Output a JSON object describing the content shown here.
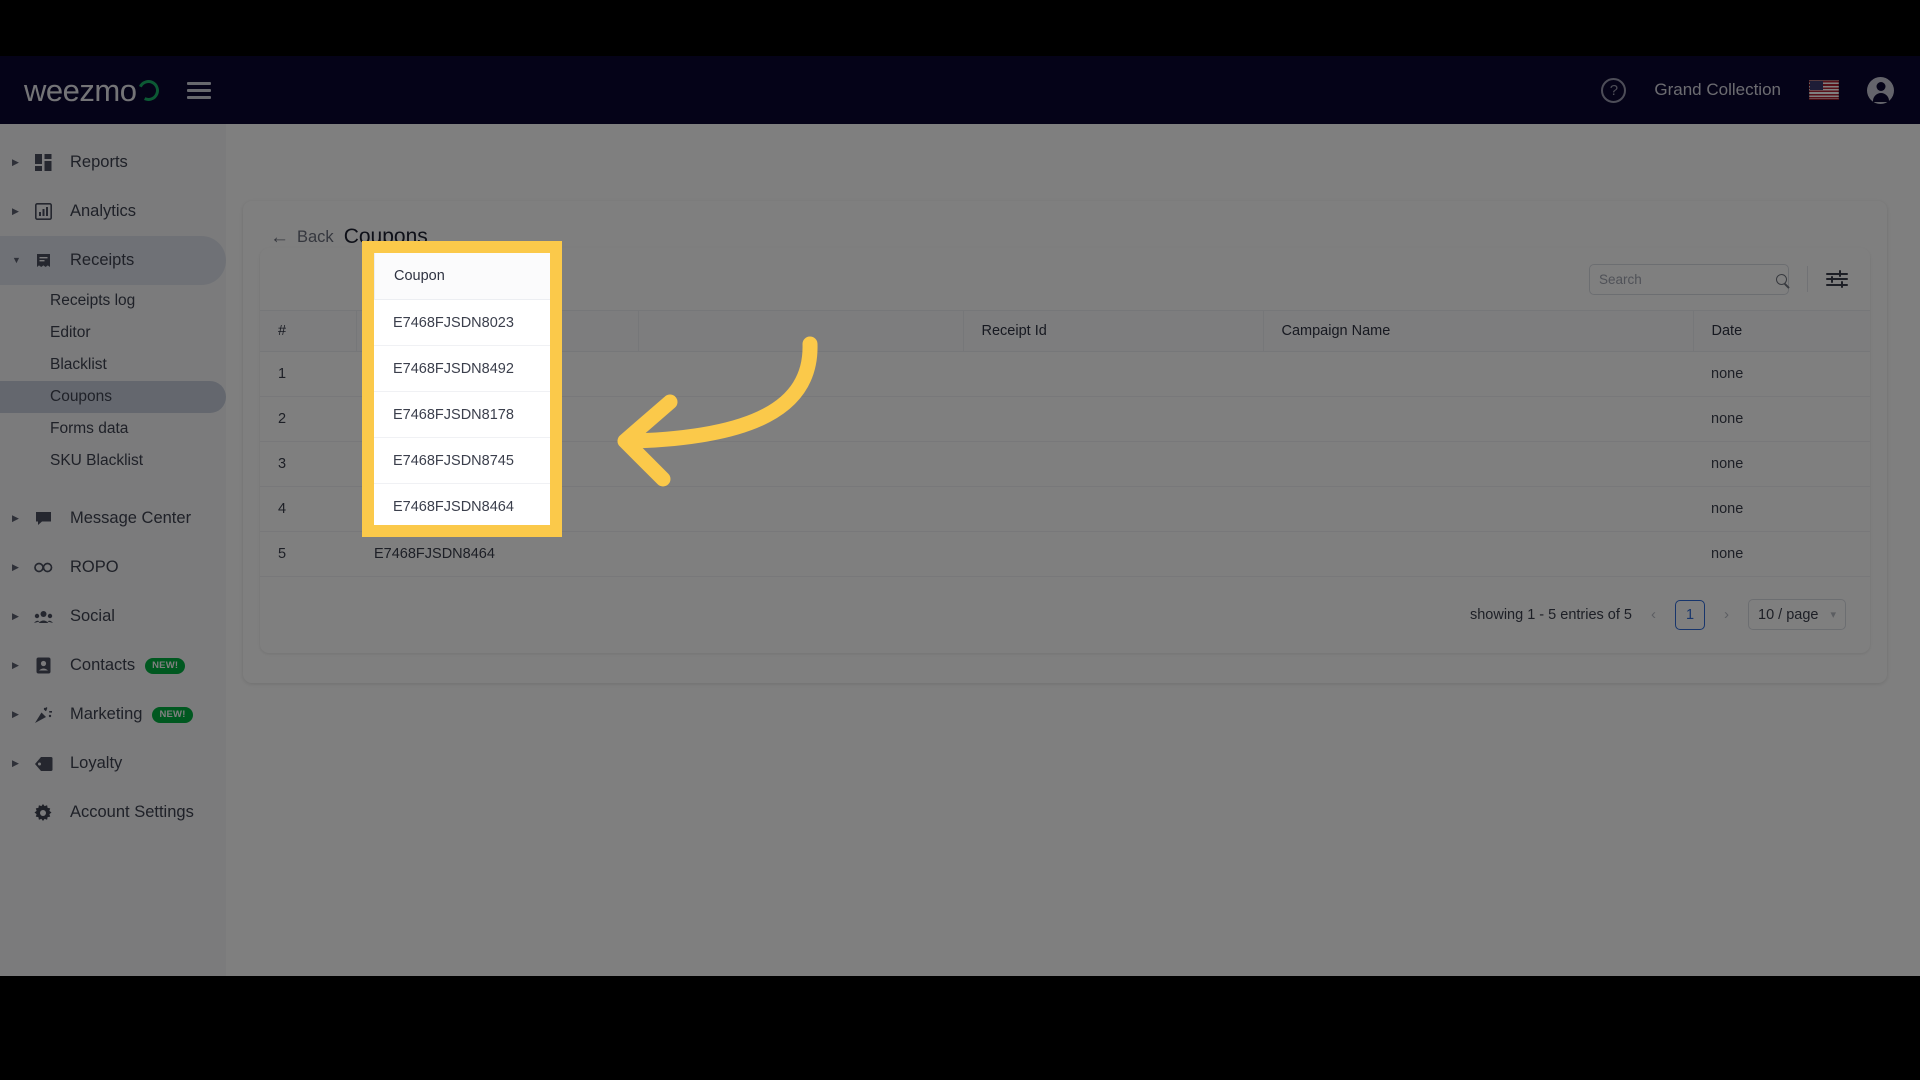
{
  "brand": {
    "name": "weezmo",
    "accent": "#18b268",
    "topbar_bg": "#0b0630"
  },
  "topbar": {
    "menu_icon": "hamburger-icon",
    "help_icon": "help-circle-icon",
    "help_glyph": "?",
    "account_name": "Grand Collection",
    "flag": "us-flag-icon",
    "avatar_icon": "account-circle-icon"
  },
  "sidebar": {
    "groups": [
      {
        "label": "Reports",
        "icon": "dashboard-grid-icon",
        "expanded": false,
        "badge": ""
      },
      {
        "label": "Analytics",
        "icon": "bar-chart-icon",
        "expanded": false,
        "badge": ""
      },
      {
        "label": "Receipts",
        "icon": "receipt-icon",
        "expanded": true,
        "badge": ""
      },
      {
        "label": "Message Center",
        "icon": "chat-bubble-icon",
        "expanded": false,
        "badge": ""
      },
      {
        "label": "ROPO",
        "icon": "infinity-icon",
        "expanded": false,
        "badge": ""
      },
      {
        "label": "Social",
        "icon": "people-group-icon",
        "expanded": false,
        "badge": ""
      },
      {
        "label": "Contacts",
        "icon": "contact-card-icon",
        "expanded": false,
        "badge": "NEW!"
      },
      {
        "label": "Marketing",
        "icon": "party-popper-icon",
        "expanded": false,
        "badge": "NEW!"
      },
      {
        "label": "Loyalty",
        "icon": "tag-icon",
        "expanded": false,
        "badge": ""
      }
    ],
    "receipts_children": [
      {
        "label": "Receipts log",
        "active": false
      },
      {
        "label": "Editor",
        "active": false
      },
      {
        "label": "Blacklist",
        "active": false
      },
      {
        "label": "Coupons",
        "active": true
      },
      {
        "label": "Forms data",
        "active": false
      },
      {
        "label": "SKU Blacklist",
        "active": false
      }
    ],
    "settings": {
      "label": "Account Settings",
      "icon": "gear-icon"
    },
    "badge_color": "#00b140"
  },
  "main": {
    "back_label": "Back",
    "back_icon": "arrow-left-icon",
    "page_title": "Coupons"
  },
  "toolbar": {
    "search_placeholder": "Search",
    "search_value": "",
    "search_icon": "search-icon",
    "filter_icon": "sliders-filter-icon"
  },
  "table": {
    "columns": [
      "#",
      "Coupon",
      "",
      "Receipt Id",
      "Campaign Name",
      "Date"
    ],
    "rows": [
      {
        "num": "1",
        "coupon": "E7468FJSDN8023",
        "blank": "",
        "receipt_id": "",
        "campaign_name": "",
        "date": "none"
      },
      {
        "num": "2",
        "coupon": "E7468FJSDN8492",
        "blank": "",
        "receipt_id": "",
        "campaign_name": "",
        "date": "none"
      },
      {
        "num": "3",
        "coupon": "E7468FJSDN8178",
        "blank": "",
        "receipt_id": "",
        "campaign_name": "",
        "date": "none"
      },
      {
        "num": "4",
        "coupon": "E7468FJSDN8745",
        "blank": "",
        "receipt_id": "",
        "campaign_name": "",
        "date": "none"
      },
      {
        "num": "5",
        "coupon": "E7468FJSDN8464",
        "blank": "",
        "receipt_id": "",
        "campaign_name": "",
        "date": "none"
      }
    ]
  },
  "pagination": {
    "summary": "showing 1 - 5 entries of 5",
    "prev_glyph": "‹",
    "next_glyph": "›",
    "current_page": "1",
    "per_page": "10 / page",
    "chevron_glyph": "∨",
    "active_color": "#2f6bd8"
  },
  "annotation": {
    "highlight_color": "#fbc94a",
    "arrow_icon": "curved-arrow-left",
    "spotlight_header": "Coupon",
    "spotlight_rows": [
      "E7468FJSDN8023",
      "E7468FJSDN8492",
      "E7468FJSDN8178",
      "E7468FJSDN8745",
      "E7468FJSDN8464"
    ]
  }
}
